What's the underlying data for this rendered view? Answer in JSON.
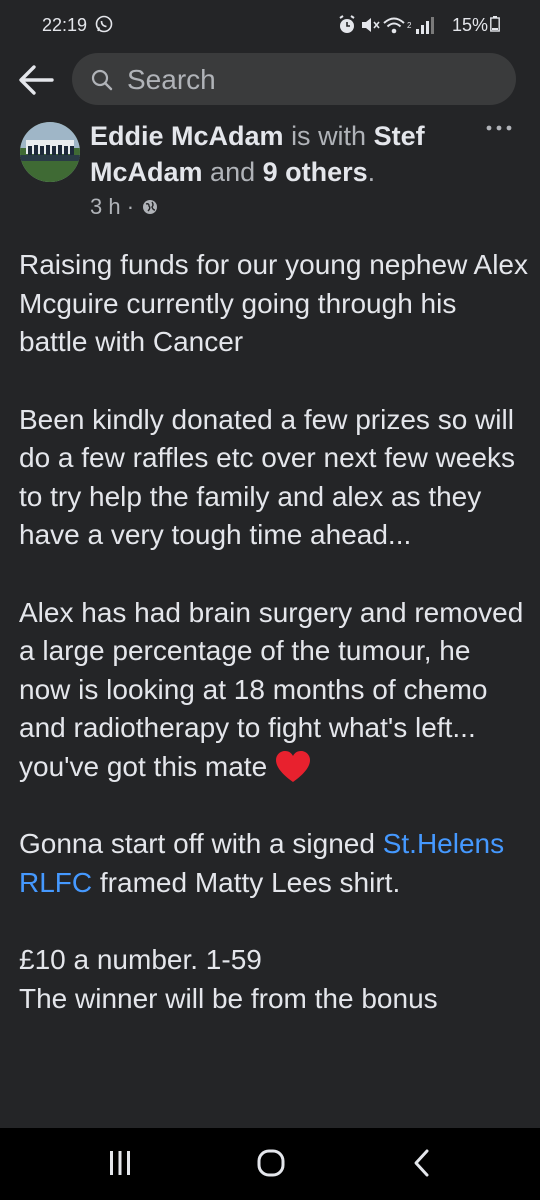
{
  "status_bar": {
    "time": "22:19",
    "battery": "15%",
    "icons": [
      "whatsapp-icon",
      "alarm-icon",
      "mute-icon",
      "wifi-icon",
      "signal-icon",
      "battery-icon"
    ]
  },
  "search": {
    "placeholder": "Search"
  },
  "post": {
    "author": "Eddie McAdam",
    "with_text": "is with",
    "tagged": "Stef McAdam",
    "and_text": "and",
    "others": "9 others",
    "period": ".",
    "time": "3 h",
    "separator": "·",
    "body": {
      "p1": "Raising funds for our young nephew Alex Mcguire currently going through his battle with Cancer",
      "p2": "Been kindly donated a few prizes so will do a few raffles etc over next few weeks to try help the family and alex as they have a very tough time ahead...",
      "p3": "Alex has had brain surgery and removed a large percentage of the tumour, he now is looking at 18 months of chemo and radiotherapy to fight what's left... you've got this mate",
      "p4_before": "Gonna start off with a signed",
      "p4_link": "St.Helens RLFC",
      "p4_after": "framed Matty Lees shirt.",
      "p5": "£10 a number. 1-59",
      "p6": "The winner will be from the bonus"
    }
  },
  "colors": {
    "background": "#242527",
    "text": "#e4e6eb",
    "muted": "#b0b3b8",
    "link": "#4599ff",
    "heart": "#e8212e"
  }
}
